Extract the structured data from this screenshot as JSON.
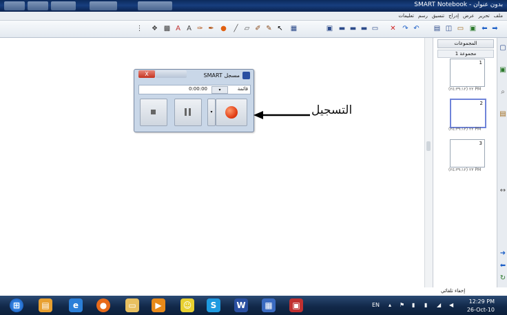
{
  "window": {
    "title": "بدون عنوان - SMART Notebook"
  },
  "menu": [
    "ملف",
    "تحرير",
    "عرض",
    "إدراج",
    "تنسيق",
    "رسم",
    "تعليمات"
  ],
  "toolbar": {
    "icons": [
      "next-page-icon",
      "previous-page-icon",
      "add-page-icon",
      "screen-shade-icon",
      "capture-icon",
      "display-icon",
      "table-icon",
      "undo-icon",
      "redo-icon",
      "delete-icon",
      "select-icon",
      "pen-icon",
      "creative-pen-icon",
      "eraser-icon",
      "line-icon",
      "shapes-icon",
      "fill-icon",
      "text-icon",
      "properties-icon",
      "more-icon"
    ]
  },
  "recorder": {
    "title": "مسجل SMART",
    "close_label": "X",
    "time": "0:00:00",
    "dropdown": "▾",
    "menu_label": "قائمة",
    "option_label": "▾"
  },
  "callout": {
    "text": "التسجيل"
  },
  "page_sorter": {
    "header": "المجموعات",
    "group_label": "مجموعة 1",
    "pages": [
      {
        "number": "1",
        "time": "(٢٤:٣٩:١٢) ٢٢ PM"
      },
      {
        "number": "2",
        "time": "(٢٤:٣٩:١٢) ٢٢ PM"
      },
      {
        "number": "3",
        "time": "(٢٤:٣٩:١٢) ٢٣ PM"
      }
    ],
    "auto_hide": "إخفاء تلقائي"
  },
  "taskbar": {
    "language": "EN",
    "time": "12:29 PM",
    "date": "26-Oct-10",
    "apps": [
      "start-orb-icon",
      "explorer-icon",
      "ie-icon",
      "firefox-icon",
      "folder-icon",
      "media-player-icon",
      "messenger-icon",
      "skype-icon",
      "word-icon",
      "notebook-icon",
      "smart-recorder-icon"
    ]
  },
  "colors": {
    "titlebar": "#173e7e",
    "taskbar": "#12294a",
    "record_red": "#e03b12",
    "selected_page": "#6f83d9"
  }
}
